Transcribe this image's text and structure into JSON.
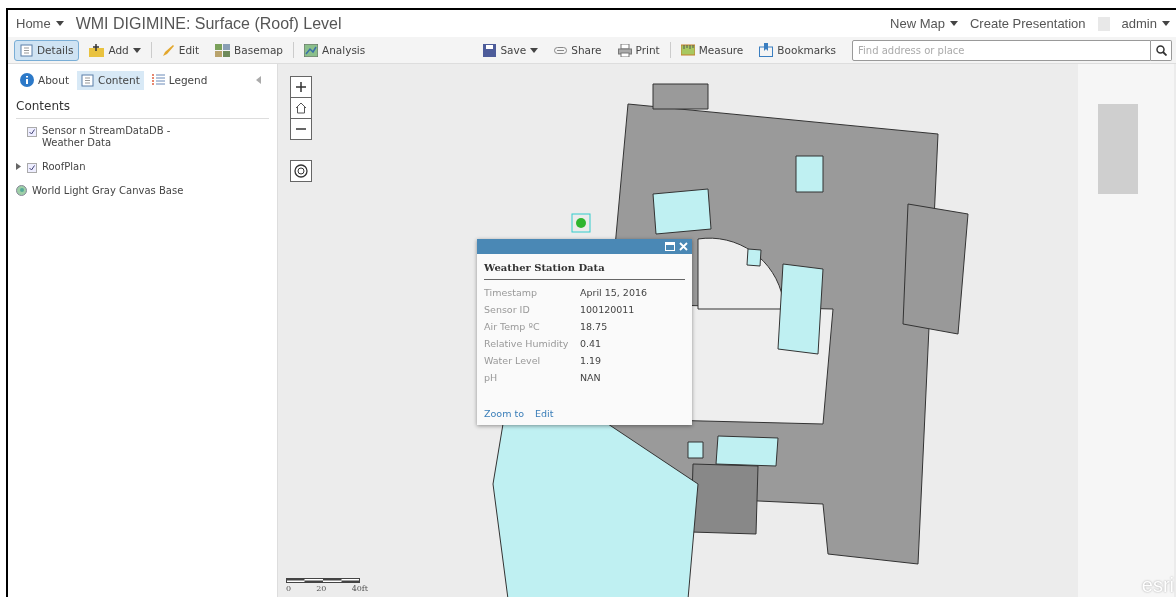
{
  "header": {
    "home": "Home",
    "title": "WMI DIGIMINE: Surface (Roof) Level",
    "links": [
      "New Map",
      "Create Presentation"
    ],
    "user": "admin"
  },
  "toolbar": {
    "left": [
      {
        "label": "Details",
        "selected": true,
        "caret": false
      },
      {
        "label": "Add",
        "selected": false,
        "caret": true
      },
      {
        "label": "Edit",
        "selected": false,
        "caret": false
      },
      {
        "label": "Basemap",
        "selected": false,
        "caret": false
      },
      {
        "label": "Analysis",
        "selected": false,
        "caret": false
      }
    ],
    "right": [
      {
        "label": "Save",
        "caret": true
      },
      {
        "label": "Share",
        "caret": false
      },
      {
        "label": "Print",
        "caret": false
      },
      {
        "label": "Measure",
        "caret": false
      },
      {
        "label": "Bookmarks",
        "caret": false
      }
    ],
    "search": {
      "placeholder": "Find address or place"
    }
  },
  "sidebar": {
    "tabs": [
      {
        "label": "About",
        "selected": false
      },
      {
        "label": "Content",
        "selected": true
      },
      {
        "label": "Legend",
        "selected": false
      }
    ],
    "heading": "Contents",
    "layers": [
      {
        "kind": "layer",
        "name": "Sensor n StreamDataDB - Weather Data",
        "checked": true,
        "expandable": false
      },
      {
        "kind": "layer",
        "name": "RoofPlan",
        "checked": true,
        "expandable": true
      },
      {
        "kind": "basemap",
        "name": "World Light Gray Canvas Base"
      }
    ]
  },
  "popup": {
    "title": "Weather Station Data",
    "fields": [
      {
        "label": "Timestamp",
        "value": "April 15, 2016"
      },
      {
        "label": "Sensor ID",
        "value": "100120011"
      },
      {
        "label": "Air Temp ºC",
        "value": "18.75"
      },
      {
        "label": "Relative Humidity",
        "value": "0.41"
      },
      {
        "label": "Water Level",
        "value": "1.19"
      },
      {
        "label": "pH",
        "value": "NAN"
      }
    ],
    "actions": [
      "Zoom to",
      "Edit"
    ]
  },
  "scale": {
    "labels": [
      "0",
      "20",
      "40ft"
    ]
  },
  "logo": "esri"
}
